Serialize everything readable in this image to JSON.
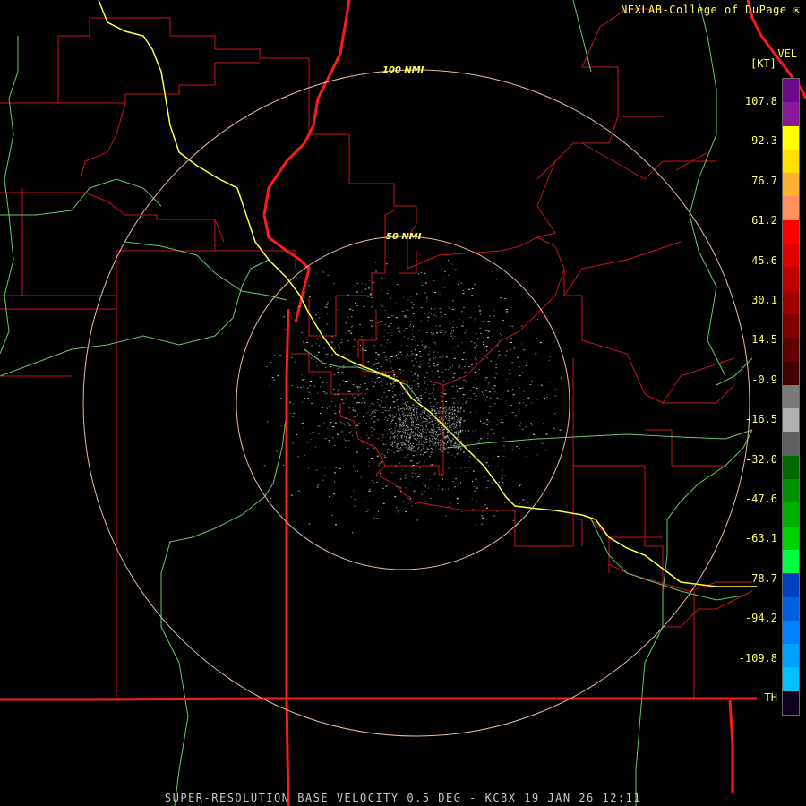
{
  "credit": "NEXLAB-College of DuPage",
  "product": "SUPER-RESOLUTION BASE VELOCITY 0.5 DEG - KCBX 19 JAN 26 12:11",
  "rings": [
    {
      "label": "100 NMI",
      "radius_nmi": 100
    },
    {
      "label": "50 NMI",
      "radius_nmi": 50
    }
  ],
  "legend": {
    "title": "VEL",
    "units": "[KT]",
    "ticks": [
      "107.8",
      "92.3",
      "76.7",
      "61.2",
      "45.6",
      "30.1",
      "14.5",
      "-0.9",
      "-16.5",
      "-32.0",
      "-47.6",
      "-63.1",
      "-78.7",
      "-94.2",
      "-109.8",
      "TH"
    ],
    "colors": [
      "#6a0a8a",
      "#8a1a9a",
      "#ffff00",
      "#ffe000",
      "#ffb030",
      "#ff9060",
      "#ff0000",
      "#e00000",
      "#c00000",
      "#a00000",
      "#800000",
      "#600000",
      "#400000",
      "#7a7a7a",
      "#b0b0b0",
      "#606060",
      "#006a00",
      "#009000",
      "#00b000",
      "#00d000",
      "#00ff40",
      "#0040c0",
      "#0060e0",
      "#0080ff",
      "#00a0ff",
      "#00c0ff",
      "#100020"
    ]
  }
}
